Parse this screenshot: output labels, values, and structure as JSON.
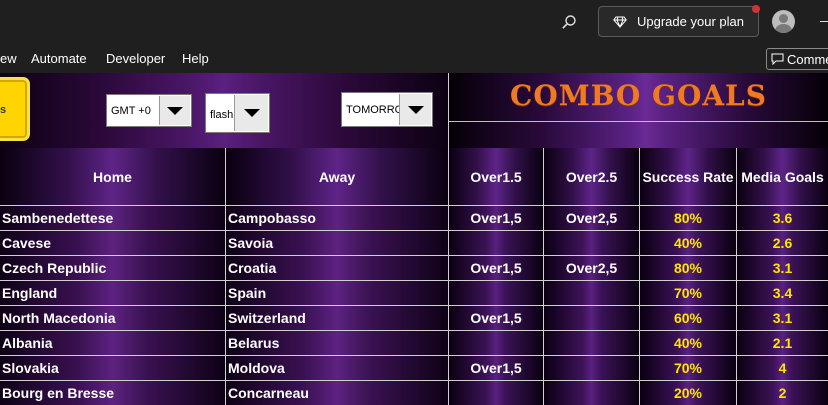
{
  "titlebar": {
    "upgrade_label": "Upgrade your plan"
  },
  "ribbon": {
    "tabs": [
      "ew",
      "Automate",
      "Developer",
      "Help"
    ],
    "comments_label": "Comme"
  },
  "controls": {
    "yellow_button_label": "s",
    "timezone": "GMT +0",
    "filter": "flash",
    "day": "TOMORRO"
  },
  "title": "COMBO GOALS",
  "colors": {
    "title": "#f07a22",
    "stat_text": "#ffe600",
    "accent_purple": "#5e2488",
    "yellow_button": "#ffd400"
  },
  "table": {
    "headers": [
      "Home",
      "Away",
      "Over1.5",
      "Over2.5",
      "Success Rate",
      "Media Goals"
    ],
    "rows": [
      {
        "home": "Sambenedettese",
        "away": "Campobasso",
        "over15": "Over1,5",
        "over25": "Over2,5",
        "rate": "80%",
        "goals": "3.6"
      },
      {
        "home": "Cavese",
        "away": "Savoia",
        "over15": "",
        "over25": "",
        "rate": "40%",
        "goals": "2.6"
      },
      {
        "home": "Czech Republic",
        "away": "Croatia",
        "over15": "Over1,5",
        "over25": "Over2,5",
        "rate": "80%",
        "goals": "3.1"
      },
      {
        "home": "England",
        "away": "Spain",
        "over15": "",
        "over25": "",
        "rate": "70%",
        "goals": "3.4"
      },
      {
        "home": "North Macedonia",
        "away": "Switzerland",
        "over15": "Over1,5",
        "over25": "",
        "rate": "60%",
        "goals": "3.1"
      },
      {
        "home": "Albania",
        "away": "Belarus",
        "over15": "",
        "over25": "",
        "rate": "40%",
        "goals": "2.1"
      },
      {
        "home": "Slovakia",
        "away": "Moldova",
        "over15": "Over1,5",
        "over25": "",
        "rate": "70%",
        "goals": "4"
      },
      {
        "home": "Bourg en Bresse",
        "away": "Concarneau",
        "over15": "",
        "over25": "",
        "rate": "20%",
        "goals": "2"
      }
    ]
  }
}
